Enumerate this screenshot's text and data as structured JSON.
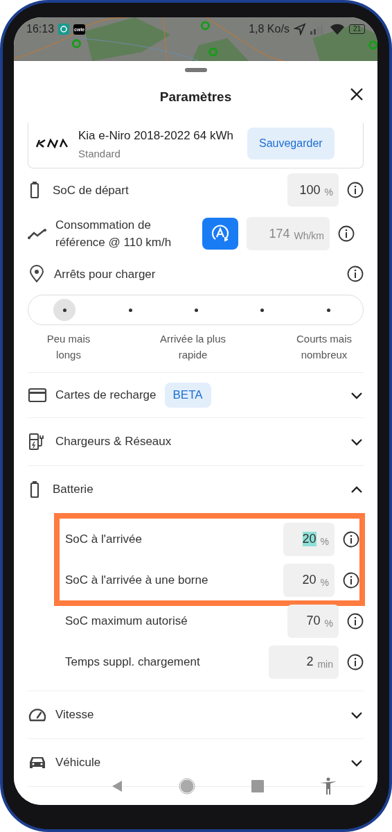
{
  "status_bar": {
    "time": "16:13",
    "app_badge": "cwle",
    "network_speed": "1,8 Ko/s",
    "battery": "21"
  },
  "sheet": {
    "title": "Paramètres"
  },
  "vehicle": {
    "name": "Kia e-Niro 2018-2022 64 kWh",
    "variant": "Standard",
    "save_button": "Sauvegarder"
  },
  "settings": [
    {
      "kind": "input",
      "label": "SoC de départ",
      "value": "100",
      "unit": "%"
    },
    {
      "kind": "input",
      "label": "Consommation de référence @ 110 km/h",
      "placeholder": "174",
      "unit": "Wh/km",
      "auto_button": true
    },
    {
      "kind": "stops",
      "label": "Arrêts pour charger"
    }
  ],
  "stops_slider": {
    "positions": [
      {
        "selected": true
      },
      {
        "selected": false
      },
      {
        "selected": false
      },
      {
        "selected": false
      },
      {
        "selected": false
      }
    ],
    "labels": [
      "Peu mais longs",
      "Arrivée la plus rapide",
      "Courts mais nombreux"
    ]
  },
  "sections": [
    {
      "label": "Cartes de recharge",
      "badge": "BETA",
      "expanded": false
    },
    {
      "label": "Chargeurs & Réseaux",
      "expanded": false
    },
    {
      "label": "Batterie",
      "expanded": true,
      "fields": [
        {
          "label": "SoC à l'arrivée",
          "value": "20",
          "unit": "%",
          "highlighted": true,
          "text_selected": true
        },
        {
          "label": "SoC à l'arrivée à une borne",
          "value": "20",
          "unit": "%",
          "highlighted": true,
          "text_selected": false
        },
        {
          "label": "SoC maximum autorisé",
          "value": "70",
          "unit": "%",
          "highlighted": false,
          "text_selected": false
        },
        {
          "label": "Temps suppl. chargement",
          "value": "2",
          "unit": "min",
          "highlighted": false,
          "text_selected": false,
          "wide": true
        }
      ]
    },
    {
      "label": "Vitesse",
      "expanded": false
    },
    {
      "label": "Véhicule",
      "expanded": false
    }
  ]
}
